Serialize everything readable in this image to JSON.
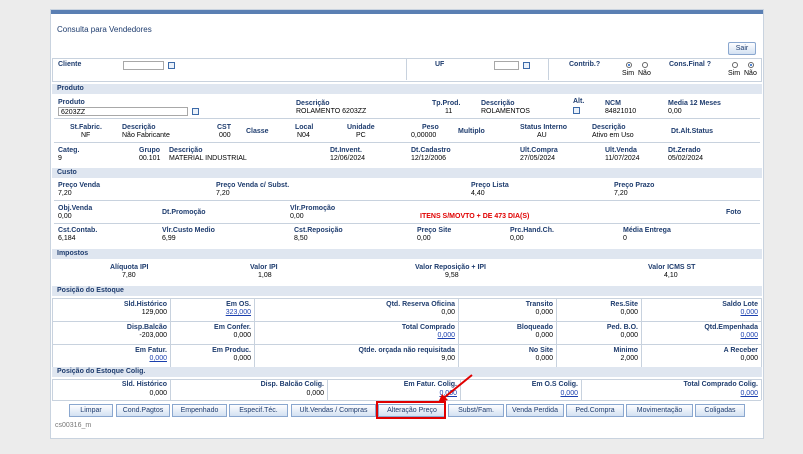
{
  "window": {
    "title": "Consulta para Vendedores",
    "exit_label": "Sair",
    "footer": "cs00316_m"
  },
  "filters": {
    "cliente_label": "Cliente",
    "cliente_value": "",
    "uf_label": "UF",
    "uf_value": "",
    "contrib_label": "Contrib.?",
    "consfinal_label": "Cons.Final ?",
    "sim": "Sim",
    "nao": "Não"
  },
  "produto": {
    "section": "Produto",
    "produto_label": "Produto",
    "produto_value": "6203ZZ",
    "descricao_label": "Descrição",
    "descricao_value": "ROLAMENTO 6203ZZ",
    "tpprod_label": "Tp.Prod.",
    "tpprod_value": "11",
    "descricao2_label": "Descrição",
    "descricao2_value": "ROLAMENTOS",
    "alt_label": "Alt.",
    "ncm_label": "NCM",
    "ncm_value": "84821010",
    "media_label": "Media 12 Meses",
    "media_value": "0,00",
    "stfabric_label": "St.Fabric.",
    "stfabric_value": "NF",
    "descfab_label": "Descrição",
    "descfab_value": "Não Fabricante",
    "cst_label": "CST",
    "cst_value": "000",
    "classe_label": "Classe",
    "local_label": "Local",
    "local_value": "N04",
    "unidade_label": "Unidade",
    "unidade_value": "PC",
    "peso_label": "Peso",
    "peso_value": "0,00000",
    "multiplo_label": "Multiplo",
    "status_label": "Status Interno",
    "status_value": "AU",
    "descstatus_label": "Descrição",
    "descstatus_value": "Ativo em Uso",
    "dtaltstatus_label": "Dt.Alt.Status",
    "categ_label": "Categ.",
    "categ_value": "9",
    "grupo_label": "Grupo",
    "grupo_value": "00.101",
    "descgrupo_label": "Descrição",
    "descgrupo_value": "MATERIAL INDUSTRIAL",
    "dtinvent_label": "Dt.Invent.",
    "dtinvent_value": "12/06/2024",
    "dtcadastro_label": "Dt.Cadastro",
    "dtcadastro_value": "12/12/2006",
    "ultcompra_label": "Ult.Compra",
    "ultcompra_value": "27/05/2024",
    "ultvenda_label": "Ult.Venda",
    "ultvenda_value": "11/07/2024",
    "dtzerado_label": "Dt.Zerado",
    "dtzerado_value": "05/02/2024"
  },
  "custo": {
    "section": "Custo",
    "precovenda_label": "Preço Venda",
    "precovenda_value": "7,20",
    "precovendast_label": "Preço Venda c/ Subst.",
    "precovendast_value": "7,20",
    "precolista_label": "Preço Lista",
    "precolista_value": "4,40",
    "precoprazo_label": "Preço Prazo",
    "precoprazo_value": "7,20",
    "objvenda_label": "Obj.Venda",
    "objvenda_value": "0,00",
    "dtpromo_label": "Dt.Promoção",
    "vlrpromo_label": "Vlr.Promoção",
    "vlrpromo_value": "0,00",
    "alert": "ITENS S/MOVTO + DE 473 DIA(S)",
    "foto_label": "Foto",
    "cstcontab_label": "Cst.Contab.",
    "cstcontab_value": "6,184",
    "vlrcusto_label": "Vlr.Custo Medio",
    "vlrcusto_value": "6,99",
    "cstrepos_label": "Cst.Reposição",
    "cstrepos_value": "8,50",
    "precosite_label": "Preço Site",
    "precosite_value": "0,00",
    "prchand_label": "Prc.Hand.Ch.",
    "prchand_value": "0,00",
    "mediaentrega_label": "Média Entrega",
    "mediaentrega_value": "0"
  },
  "impostos": {
    "section": "Impostos",
    "aliqipi_label": "Alíquota IPI",
    "aliqipi_value": "7,80",
    "valoripi_label": "Valor IPI",
    "valoripi_value": "1,08",
    "valorrep_label": "Valor Reposição + IPI",
    "valorrep_value": "9,58",
    "valoricms_label": "Valor ICMS ST",
    "valoricms_value": "4,10"
  },
  "estoque": {
    "section": "Posição do Estoque",
    "rows": [
      [
        [
          "Sld.Histórico",
          "129,000",
          false
        ],
        [
          "Em OS.",
          "323,000",
          true
        ],
        [
          "Qtd. Reserva Oficina",
          "0,00",
          false
        ],
        [
          "Transito",
          "0,000",
          false
        ],
        [
          "Res.Site",
          "0,000",
          false
        ],
        [
          "Saldo Lote",
          "0,000",
          true
        ]
      ],
      [
        [
          "Disp.Balcão",
          "-203,000",
          false
        ],
        [
          "Em Confer.",
          "0,000",
          false
        ],
        [
          "Total Comprado",
          "0,000",
          true
        ],
        [
          "Bloqueado",
          "0,000",
          false
        ],
        [
          "Ped. B.O.",
          "0,000",
          false
        ],
        [
          "Qtd.Empenhada",
          "0,000",
          true
        ]
      ],
      [
        [
          "Em Fatur.",
          "0,000",
          true
        ],
        [
          "Em Produc.",
          "0,000",
          false
        ],
        [
          "Qtde. orçada não requisitada",
          "9,00",
          false
        ],
        [
          "No Site",
          "0,000",
          false
        ],
        [
          "Minimo",
          "2,000",
          false
        ],
        [
          "A Receber",
          "0,000",
          false
        ]
      ]
    ]
  },
  "estoquecolig": {
    "section": "Posição do Estoque Colig.",
    "cells": [
      [
        "Sld. Histórico",
        "0,000",
        false
      ],
      [
        "Disp. Balcão Colig.",
        "0,000",
        false
      ],
      [
        "Em Fatur. Colig.",
        "0,000",
        true
      ],
      [
        "Em O.S Colig.",
        "0,000",
        true
      ],
      [
        "Total Comprado Colig.",
        "0,000",
        true
      ]
    ]
  },
  "tabs": [
    "Limpar",
    "Cond.Pagtos",
    "Empenhado",
    "Especif.Téc.",
    "Ult.Vendas / Compras",
    "Alteração Preço",
    "Subst/Fam.",
    "Venda Perdida",
    "Ped.Compra",
    "Movimentação",
    "Coligadas"
  ],
  "colors": {
    "accent": "#1e3c6e",
    "highlight": "#e00000"
  }
}
